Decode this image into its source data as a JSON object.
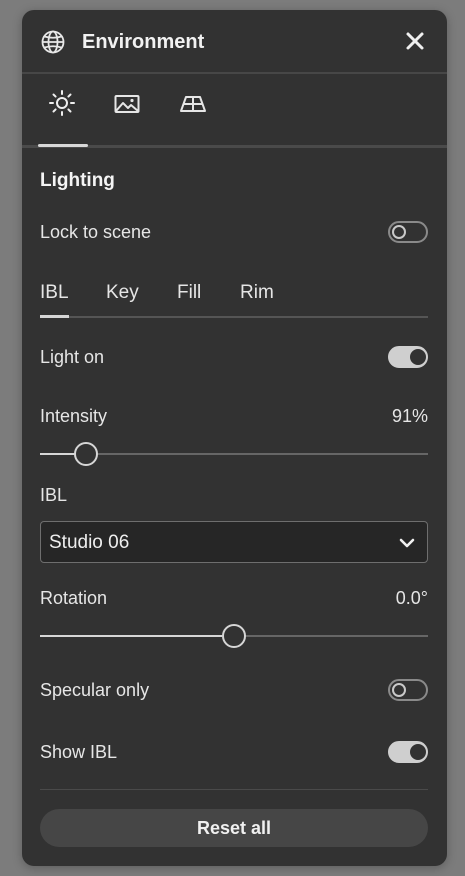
{
  "panel": {
    "title": "Environment"
  },
  "tabs": [
    {
      "name": "lighting-tab",
      "icon": "sun-icon",
      "active": true
    },
    {
      "name": "background-tab",
      "icon": "image-icon",
      "active": false
    },
    {
      "name": "ground-tab",
      "icon": "ground-plane-icon",
      "active": false
    }
  ],
  "section": {
    "title": "Lighting"
  },
  "lock_to_scene": {
    "label": "Lock to scene",
    "on": false
  },
  "light_tabs": {
    "items": [
      "IBL",
      "Key",
      "Fill",
      "Rim"
    ],
    "active": "IBL"
  },
  "light_on": {
    "label": "Light on",
    "on": true
  },
  "intensity": {
    "label": "Intensity",
    "value_text": "91%",
    "fraction": 0.09
  },
  "ibl": {
    "label": "IBL",
    "selected": "Studio 06"
  },
  "rotation": {
    "label": "Rotation",
    "value_text": "0.0°",
    "fraction": 0.5
  },
  "specular_only": {
    "label": "Specular only",
    "on": false
  },
  "show_ibl": {
    "label": "Show IBL",
    "on": true
  },
  "reset": {
    "label": "Reset all"
  }
}
